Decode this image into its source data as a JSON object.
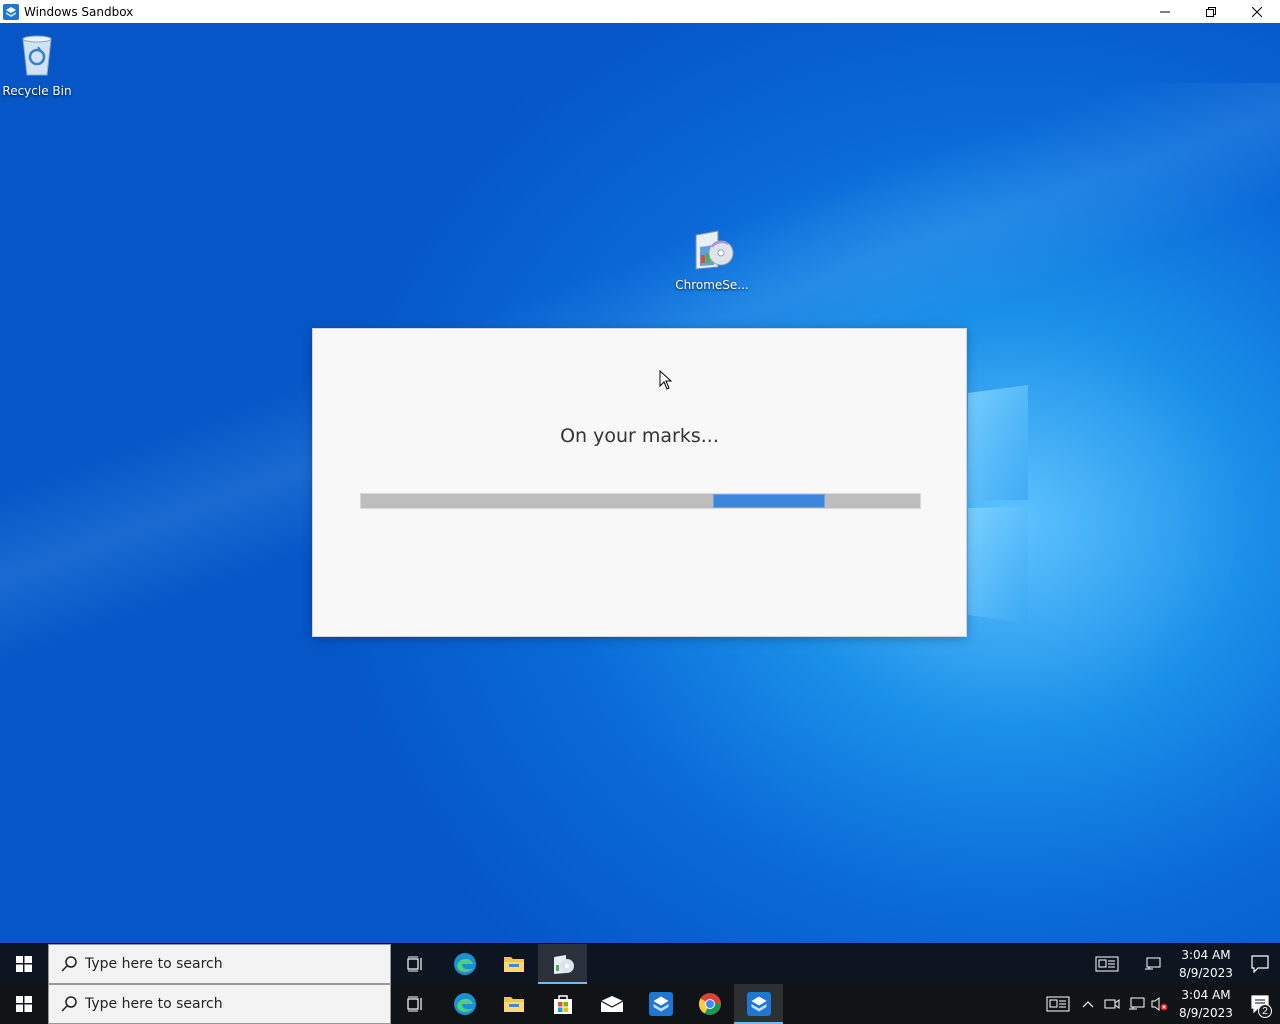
{
  "window": {
    "title": "Windows Sandbox",
    "icon": "sandbox-icon",
    "controls": [
      "minimize-icon",
      "restore-icon",
      "close-icon"
    ]
  },
  "desktop": {
    "icons": [
      {
        "label": "Recycle Bin",
        "icon": "recycle-bin-icon"
      },
      {
        "label": "ChromeSe...",
        "icon": "installer-icon"
      }
    ]
  },
  "dialog": {
    "message": "On your marks...",
    "progress_start": 0.63,
    "progress_width": 0.2,
    "accent": "#3d86de"
  },
  "taskbar_inner": {
    "search_placeholder": "Type here to search",
    "apps": [
      "task-view-icon",
      "edge-icon",
      "file-explorer-icon",
      "installer-icon"
    ],
    "time": "3:04 AM",
    "date": "8/9/2023"
  },
  "taskbar_outer": {
    "search_placeholder": "Type here to search",
    "apps": [
      "task-view-icon",
      "edge-icon",
      "file-explorer-icon",
      "store-icon",
      "mail-icon",
      "sandbox-icon",
      "chrome-icon",
      "sandbox-icon"
    ],
    "time": "3:04 AM",
    "date": "8/9/2023",
    "notification_count": "2"
  }
}
